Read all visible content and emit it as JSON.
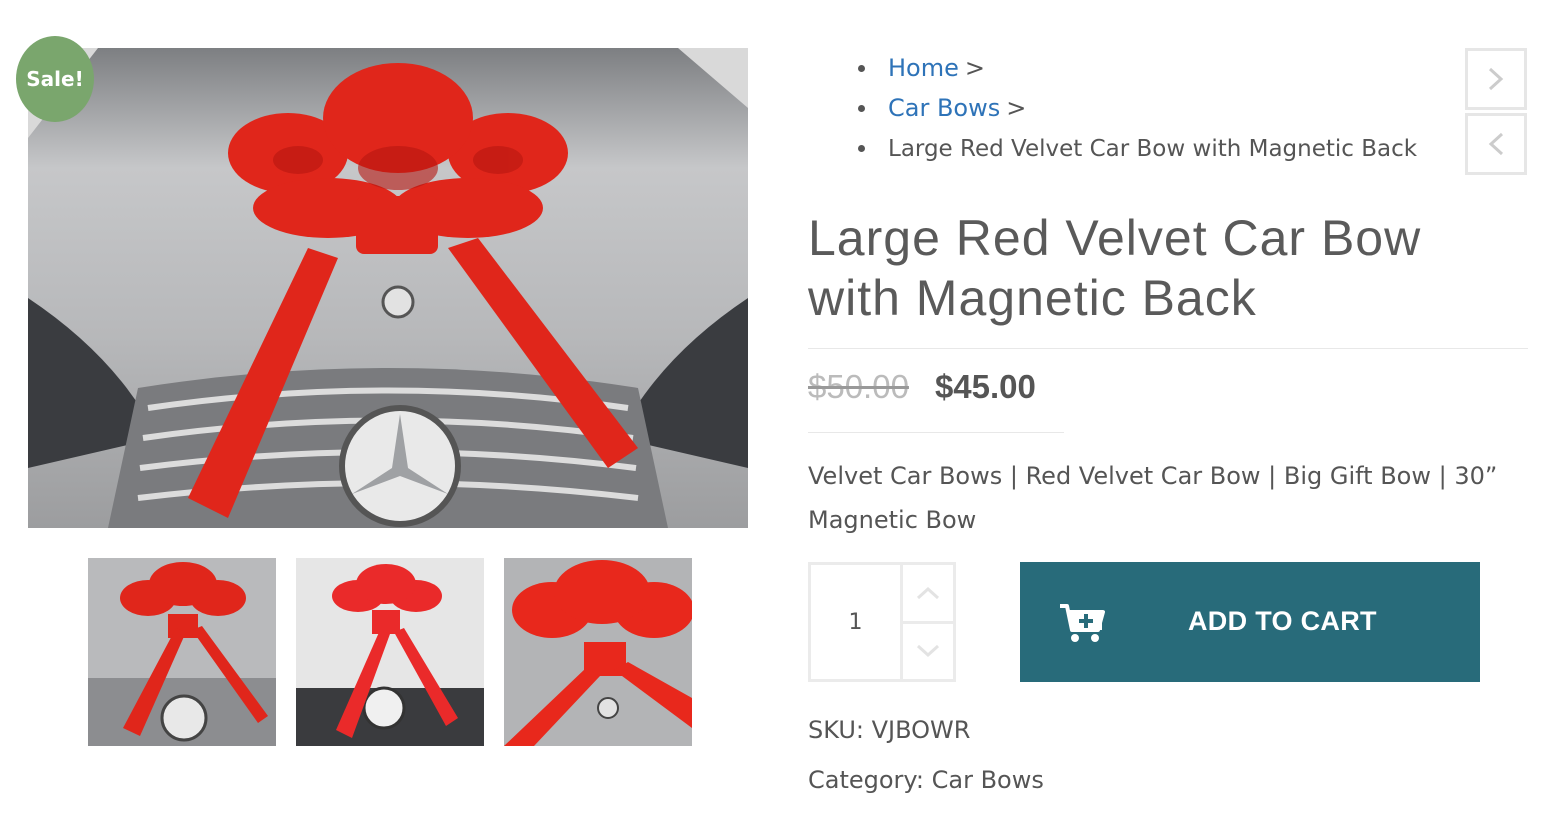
{
  "gallery": {
    "sale_badge": "Sale!",
    "thumbnail_count": 3
  },
  "breadcrumb": {
    "items": [
      {
        "label": "Home",
        "separator": ">"
      },
      {
        "label": "Car Bows",
        "separator": ">"
      },
      {
        "label": "Large Red Velvet Car Bow with Magnetic Back"
      }
    ]
  },
  "nav": {
    "next_icon": "chevron-right-icon",
    "prev_icon": "chevron-left-icon"
  },
  "product": {
    "title": "Large Red Velvet Car Bow with Magnetic Back",
    "price_old": "$50.00",
    "price_new": "$45.00",
    "short_description": "Velvet Car Bows | Red Velvet Car Bow | Big Gift Bow | 30” Magnetic Bow",
    "quantity": "1",
    "add_to_cart_label": "ADD TO CART",
    "sku_label": "SKU:",
    "sku_value": "VJBOWR",
    "category_label": "Category:",
    "category_value": "Car Bows"
  },
  "colors": {
    "sale_badge": "#7aa66d",
    "link": "#2e73b8",
    "cart_button": "#286b7a",
    "bow_red": "#e0261b"
  }
}
